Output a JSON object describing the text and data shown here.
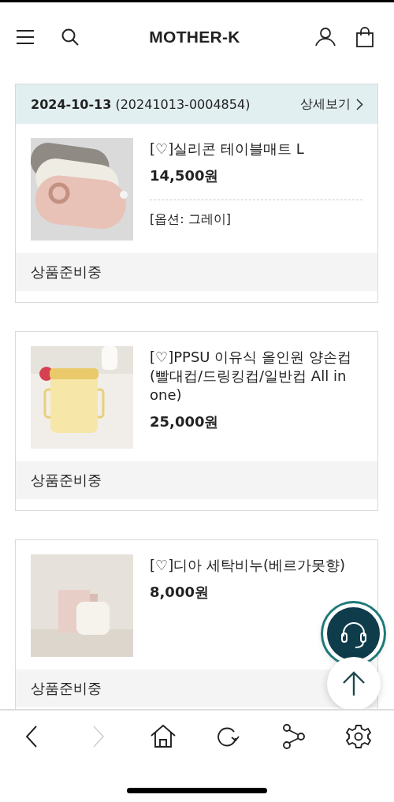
{
  "header": {
    "logo": "MOTHER-K"
  },
  "order": {
    "date": "2024-10-13",
    "number": "(20241013-0004854)",
    "detail_link": "상세보기"
  },
  "items": [
    {
      "name": "[♡]실리콘 테이블매트 L",
      "price": "14,500원",
      "option": "[옵션: 그레이]",
      "status": "상품준비중"
    },
    {
      "name": "[♡]PPSU 이유식 올인원 양손컵(빨대컵/드링킹컵/일반컵 All in one)",
      "price": "25,000원",
      "status": "상품준비중"
    },
    {
      "name": "[♡]디아 세탁비누(베르가못향)",
      "price": "8,000원",
      "status": "상품준비중"
    }
  ],
  "nav": [
    {
      "kind": "back",
      "disabled": false
    },
    {
      "kind": "forward",
      "disabled": true
    },
    {
      "kind": "home",
      "disabled": false
    },
    {
      "kind": "reload",
      "disabled": false
    },
    {
      "kind": "share",
      "disabled": false
    },
    {
      "kind": "settings",
      "disabled": false
    }
  ]
}
